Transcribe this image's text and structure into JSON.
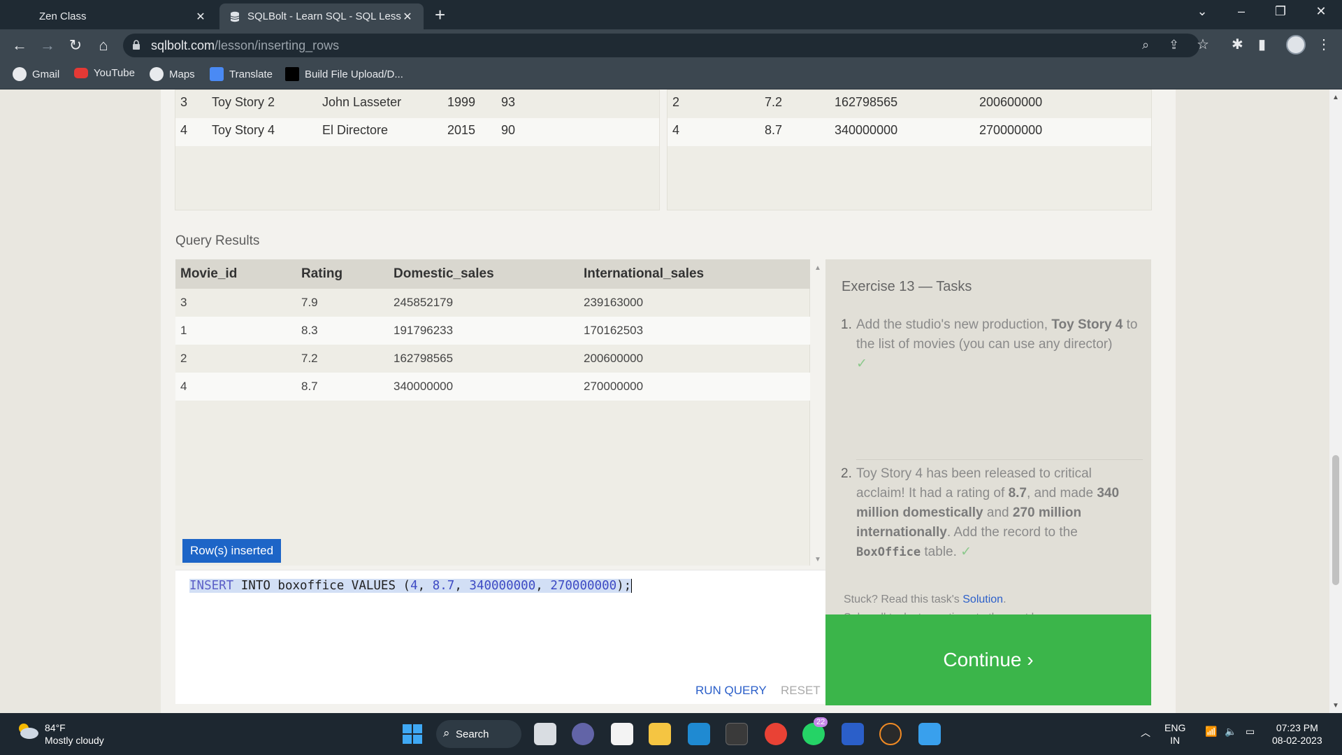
{
  "browser": {
    "tabs": [
      {
        "title": "Zen Class"
      },
      {
        "title": "SQLBolt - Learn SQL - SQL Lessor"
      }
    ],
    "new_tab_label": "+",
    "url_host": "sqlbolt.com",
    "url_path": "/lesson/inserting_rows",
    "bookmarks": [
      "Gmail",
      "YouTube",
      "Maps",
      "Translate",
      "Build File Upload/D..."
    ]
  },
  "movies_table": {
    "rows": [
      [
        "3",
        "Toy Story 2",
        "John Lasseter",
        "1999",
        "93"
      ],
      [
        "4",
        "Toy Story 4",
        "El Directore",
        "2015",
        "90"
      ]
    ]
  },
  "boxoffice_table": {
    "rows": [
      [
        "2",
        "7.2",
        "162798565",
        "200600000"
      ],
      [
        "4",
        "8.7",
        "340000000",
        "270000000"
      ]
    ]
  },
  "query_results": {
    "label": "Query Results",
    "headers": [
      "Movie_id",
      "Rating",
      "Domestic_sales",
      "International_sales"
    ],
    "rows": [
      [
        "3",
        "7.9",
        "245852179",
        "239163000"
      ],
      [
        "1",
        "8.3",
        "191796233",
        "170162503"
      ],
      [
        "2",
        "7.2",
        "162798565",
        "200600000"
      ],
      [
        "4",
        "8.7",
        "340000000",
        "270000000"
      ]
    ],
    "status_badge": "Row(s) inserted"
  },
  "editor": {
    "kw_insert": "INSERT",
    "mid": " INTO boxoffice VALUES (",
    "v1": "4",
    "v2": "8.7",
    "v3": "340000000",
    "v4": "270000000",
    "sep": ", ",
    "end": ");",
    "run_label": "RUN QUERY",
    "reset_label": "RESET"
  },
  "exercise": {
    "title": "Exercise 13 — Tasks",
    "task1": {
      "num": "1.",
      "pre": "Add the studio's new production, ",
      "bold": "Toy Story 4",
      "post": " to the list of movies (you can use any director)",
      "check": "✓"
    },
    "task2": {
      "num": "2.",
      "p1": "Toy Story 4 has been released to critical acclaim! It had a rating of ",
      "b1": "8.7",
      "p2": ", and made ",
      "b2": "340 million domestically",
      "p3": " and ",
      "b3": "270 million internationally",
      "p4": ". Add the record to the ",
      "code": "BoxOffice",
      "p5": " table.",
      "check": "✓"
    },
    "stuck_pre": "Stuck? Read this task's ",
    "stuck_link": "Solution",
    "stuck_post": ".",
    "solve_note": "Solve all tasks to continue to the next lesson.",
    "continue_label": "Continue ›"
  },
  "taskbar": {
    "weather_temp": "84°F",
    "weather_desc": "Mostly cloudy",
    "search_label": "Search",
    "whatsapp_badge": "22",
    "lang_1": "ENG",
    "lang_2": "IN",
    "time": "07:23 PM",
    "date": "08-02-2023"
  },
  "colors": {
    "accent_blue": "#1d65c7",
    "continue_green": "#3bb54a",
    "tab_bar": "#1f2a33",
    "toolbar": "#3c4750"
  }
}
